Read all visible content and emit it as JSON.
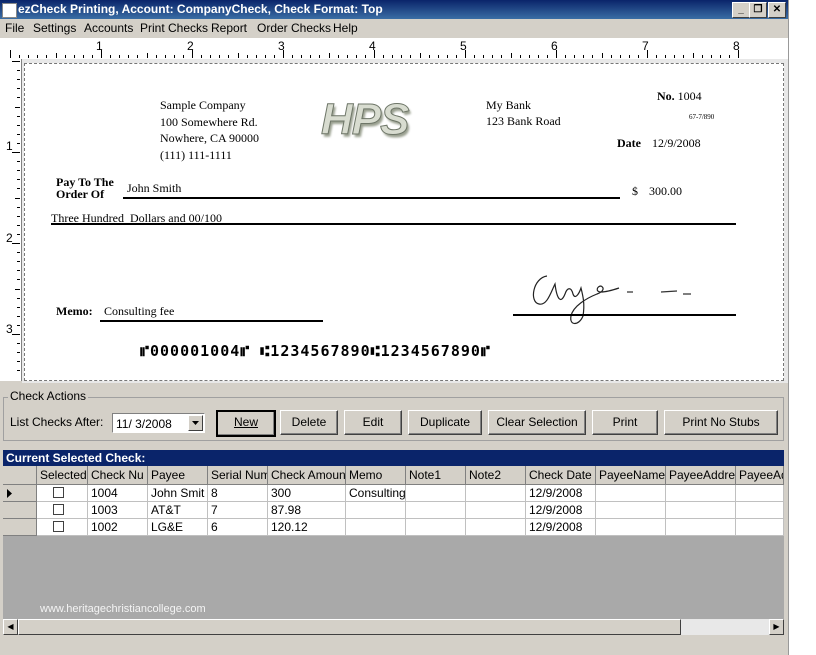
{
  "window": {
    "title": "ezCheck Printing, Account: CompanyCheck, Check Format: Top",
    "minimize": "_",
    "restore": "❐",
    "close": "✕"
  },
  "menu": [
    "File",
    "Settings",
    "Accounts",
    "Print Checks",
    "Report",
    "Order Checks",
    "Help"
  ],
  "ruler": {
    "top_labels": [
      "1",
      "2",
      "3",
      "4",
      "5",
      "6",
      "7",
      "8"
    ],
    "left_labels": [
      "1",
      "2",
      "3"
    ]
  },
  "check": {
    "company": [
      "Sample Company",
      "100 Somewhere Rd.",
      "Nowhere, CA 90000",
      "(111) 111-1111"
    ],
    "logo": "HPS",
    "bank": [
      "My Bank",
      "123 Bank Road"
    ],
    "no_label": "No.",
    "no_value": "1004",
    "fraction": "67-7/890",
    "date_label": "Date",
    "date_value": "12/9/2008",
    "pay_to_label_1": "Pay To The",
    "pay_to_label_2": "Order Of",
    "payee": "John Smith",
    "currency": "$",
    "amount": "300.00",
    "amount_words": "Three Hundred  Dollars and 00/100",
    "memo_label": "Memo:",
    "memo_value": "Consulting fee",
    "micr": "⑈000001004⑈ ⑆1234567890⑆1234567890⑈"
  },
  "actions": {
    "group_label": "Check Actions",
    "list_label": "List Checks After:",
    "date": "11/ 3/2008",
    "buttons": [
      "New",
      "Delete",
      "Edit",
      "Duplicate",
      "Clear Selection",
      "Print",
      "Print No Stubs"
    ]
  },
  "selected": {
    "header": "Current Selected Check:",
    "columns": [
      "Selected",
      "Check Nu",
      "Payee",
      "Serial Num",
      "Check Amount",
      "Memo",
      "Note1",
      "Note2",
      "Check Date",
      "PayeeName",
      "PayeeAddre",
      "PayeeAd"
    ],
    "rows": [
      {
        "check_no": "1004",
        "payee": "John Smit",
        "serial": "8",
        "amount": "300",
        "memo": "Consulting",
        "date": "12/9/2008"
      },
      {
        "check_no": "1003",
        "payee": "AT&T",
        "serial": "7",
        "amount": "87.98",
        "memo": "",
        "date": "12/9/2008"
      },
      {
        "check_no": "1002",
        "payee": "LG&E",
        "serial": "6",
        "amount": "120.12",
        "memo": "",
        "date": "12/9/2008"
      }
    ]
  },
  "watermark": "www.heritagechristiancollege.com",
  "scroll": {
    "left": "◀",
    "right": "▶"
  }
}
